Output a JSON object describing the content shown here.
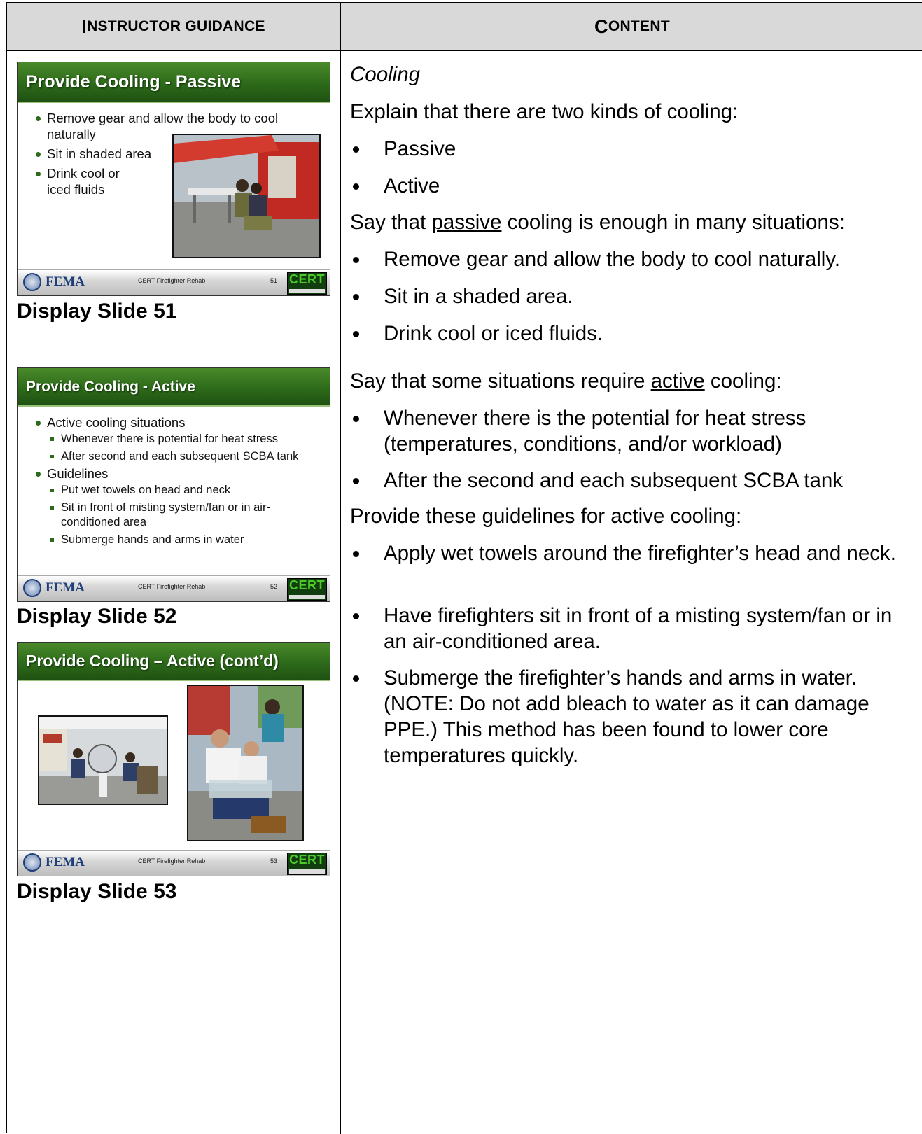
{
  "header": {
    "left_first": "I",
    "left_rest": "NSTRUCTOR GUIDANCE",
    "right_first": "C",
    "right_rest": "ONTENT"
  },
  "slides": [
    {
      "title": "Provide Cooling - Passive",
      "bullets": [
        {
          "level": 1,
          "text": "Remove gear and allow the body to cool"
        },
        {
          "level": 1,
          "text": "naturally",
          "cont": true
        },
        {
          "level": 1,
          "text": "Sit in shaded area"
        },
        {
          "level": 1,
          "text": "Drink cool or"
        },
        {
          "level": 1,
          "text": "iced fluids",
          "cont": true
        }
      ],
      "footer_org": "FEMA",
      "footer_course": "CERT Firefighter Rehab",
      "footer_num": "51",
      "cert_logo": "CERT",
      "label": "Display Slide 51"
    },
    {
      "title": "Provide Cooling - Active",
      "bullets": [
        {
          "level": 1,
          "text": "Active cooling situations"
        },
        {
          "level": 2,
          "text": "Whenever there is potential for heat stress"
        },
        {
          "level": 2,
          "text": "After second and each subsequent SCBA tank"
        },
        {
          "level": 1,
          "text": "Guidelines"
        },
        {
          "level": 2,
          "text": "Put wet towels on head and neck"
        },
        {
          "level": 2,
          "text": "Sit in front of misting system/fan or in air-"
        },
        {
          "level": 2,
          "text": "conditioned area",
          "cont": true
        },
        {
          "level": 2,
          "text": "Submerge hands and arms in water"
        }
      ],
      "footer_org": "FEMA",
      "footer_course": "CERT Firefighter Rehab",
      "footer_num": "52",
      "cert_logo": "CERT",
      "label": "Display Slide 52"
    },
    {
      "title": "Provide Cooling – Active (cont’d)",
      "footer_org": "FEMA",
      "footer_course": "CERT Firefighter Rehab",
      "footer_num": "53",
      "cert_logo": "CERT",
      "label": "Display Slide 53"
    }
  ],
  "content": {
    "heading": "Cooling",
    "intro": "Explain that there are two kinds of cooling:",
    "kinds": [
      "Passive",
      "Active"
    ],
    "passive_intro_a": "Say that ",
    "passive_intro_u": "passive",
    "passive_intro_b": " cooling is enough in many situations:",
    "passive_items": [
      "Remove gear and allow the body to cool naturally.",
      "Sit in a shaded area.",
      "Drink cool or iced fluids."
    ],
    "active_intro_a": "Say that some situations require ",
    "active_intro_u": "active",
    "active_intro_b": " cooling:",
    "active_items": [
      "Whenever there is the potential for heat stress (temperatures, conditions, and/or workload)",
      "After the second and each subsequent SCBA tank"
    ],
    "guidelines_intro": "Provide these guidelines for active cooling:",
    "guidelines": [
      "Apply wet towels around the firefighter’s head and neck.",
      "Have firefighters sit in front of a misting system/fan or in an air-conditioned area.",
      "Submerge the firefighter’s hands and arms in water. (NOTE: Do not add bleach to water as it can damage PPE.)  This method has been found to lower core temperatures quickly."
    ]
  }
}
